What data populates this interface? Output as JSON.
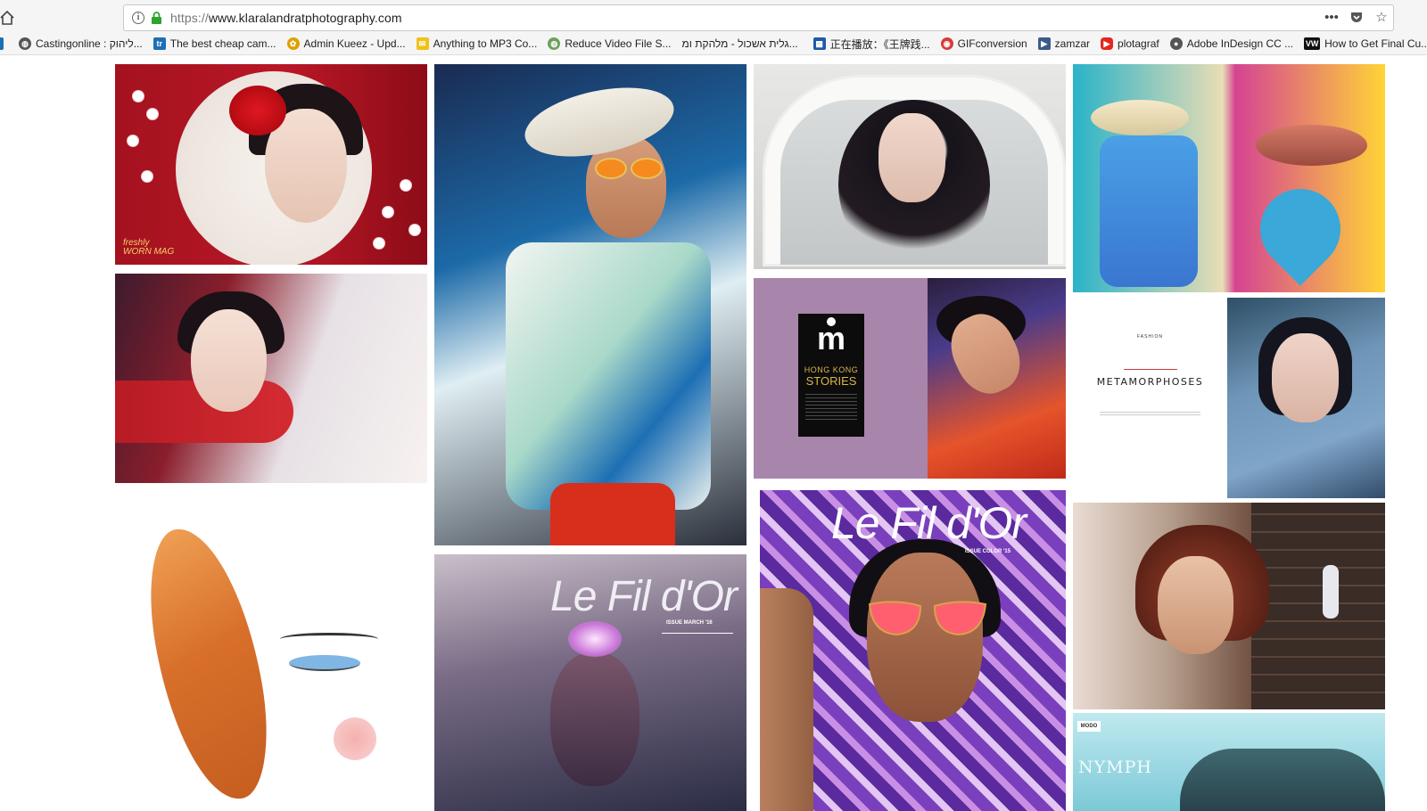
{
  "browser": {
    "url_protocol": "https://",
    "url_host": "www.klaralandratphotography.com",
    "bookmarks": [
      {
        "label": "Castingonline : ליהוק...",
        "icon": "globe-icon",
        "color": "#555555"
      },
      {
        "label": "The best cheap cam...",
        "icon": "tr-icon",
        "color": "#1b6fb5"
      },
      {
        "label": "Admin Kueez - Upd...",
        "icon": "bee-icon",
        "color": "#e0a000"
      },
      {
        "label": "Anything to MP3 Co...",
        "icon": "mail-icon",
        "color": "#f0c21a"
      },
      {
        "label": "Reduce Video File S...",
        "icon": "globe-icon",
        "color": "#6fa05c"
      },
      {
        "label": "גלית אשכול - מלהקת ומ...",
        "icon": "globe-icon",
        "color": "#888888"
      },
      {
        "label": "正在播放：《王牌践...",
        "icon": "app-icon",
        "color": "#1f5aa8"
      },
      {
        "label": "GIFconversion",
        "icon": "gif-icon",
        "color": "#d83a3a"
      },
      {
        "label": "zamzar",
        "icon": "zamzar-icon",
        "color": "#3e5a8a"
      },
      {
        "label": "plotagraf",
        "icon": "youtube-icon",
        "color": "#e52620"
      },
      {
        "label": "Adobe InDesign CC ...",
        "icon": "apple-icon",
        "color": "#555555"
      },
      {
        "label": "How to Get Final Cu...",
        "icon": "vw-icon",
        "color": "#111111"
      }
    ]
  },
  "gallery": {
    "tile1_logo_line1": "freshly",
    "tile1_logo_line2": "WORN MAG",
    "hk_line1": "HONG KONG",
    "hk_line2": "STORIES",
    "hk_mark": "m",
    "lefildor_title": "Le Fil d'Or",
    "lefildor_issue_march": "ISSUE MARCH '16",
    "lefildor_issue_color": "ISSUE COLOR '15",
    "metamorphoses_small": "FASHION",
    "metamorphoses_title": "METAMORPHOSES",
    "nymph_tag": "MODO",
    "nymph_title": "NYMPH"
  }
}
